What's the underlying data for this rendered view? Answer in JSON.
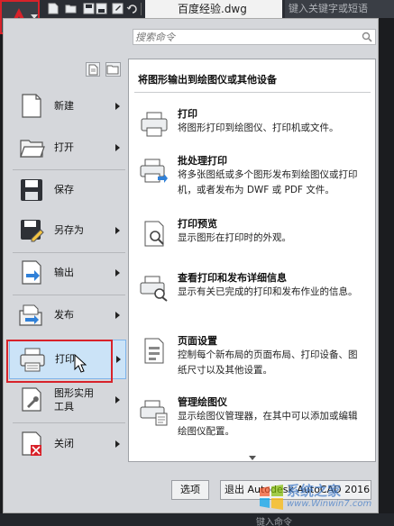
{
  "titlebar": {
    "document_title": "百度经验.dwg",
    "search_placeholder": "键入关键字或短语",
    "quick_access_icons": [
      "new-icon",
      "open-icon",
      "save-icon",
      "saveas-icon",
      "print-icon",
      "undo-icon"
    ]
  },
  "menu": {
    "search_placeholder": "搜索命令",
    "left_items": [
      {
        "label": "新建",
        "icon": "new-file-icon",
        "has_arrow": true
      },
      {
        "label": "打开",
        "icon": "open-folder-icon",
        "has_arrow": true
      },
      {
        "label": "保存",
        "icon": "save-icon",
        "has_arrow": false
      },
      {
        "label": "另存为",
        "icon": "save-as-icon",
        "has_arrow": true
      },
      {
        "label": "输出",
        "icon": "export-icon",
        "has_arrow": true
      },
      {
        "label": "发布",
        "icon": "publish-icon",
        "has_arrow": true
      },
      {
        "label": "打印",
        "icon": "printer-icon",
        "has_arrow": true,
        "active": true
      },
      {
        "label": "图形实用\n工具",
        "icon": "drawing-utilities-icon",
        "has_arrow": true
      },
      {
        "label": "关闭",
        "icon": "close-file-icon",
        "has_arrow": true
      }
    ],
    "submenu": {
      "header": "将图形输出到绘图仪或其他设备",
      "items": [
        {
          "title": "打印",
          "desc": "将图形打印到绘图仪、打印机或文件。",
          "icon": "plot-icon"
        },
        {
          "title": "批处理打印",
          "desc": "将多张图纸或多个图形发布到绘图仪或打印机，或者发布为 DWF 或 PDF 文件。",
          "icon": "batch-plot-icon"
        },
        {
          "title": "打印预览",
          "desc": "显示图形在打印时的外观。",
          "icon": "plot-preview-icon"
        },
        {
          "title": "查看打印和发布详细信息",
          "desc": "显示有关已完成的打印和发布作业的信息。",
          "icon": "plot-details-icon"
        },
        {
          "title": "页面设置",
          "desc": "控制每个新布局的页面布局、打印设备、图纸尺寸以及其他设置。",
          "icon": "page-setup-icon"
        },
        {
          "title": "管理绘图仪",
          "desc": "显示绘图仪管理器，在其中可以添加或编辑绘图仪配置。",
          "icon": "plotter-manager-icon"
        }
      ]
    },
    "options_label": "选项",
    "exit_label": "退出 Autodesk AutoCAD 2016"
  },
  "watermark": {
    "title": "系统之家",
    "url": "www.Winwin7.com"
  },
  "status": {
    "command_prompt": "键入命令"
  },
  "colors": {
    "highlight_red": "#d8222a",
    "active_blue": "#cbe3f7",
    "menu_bg": "#d5d7db"
  }
}
